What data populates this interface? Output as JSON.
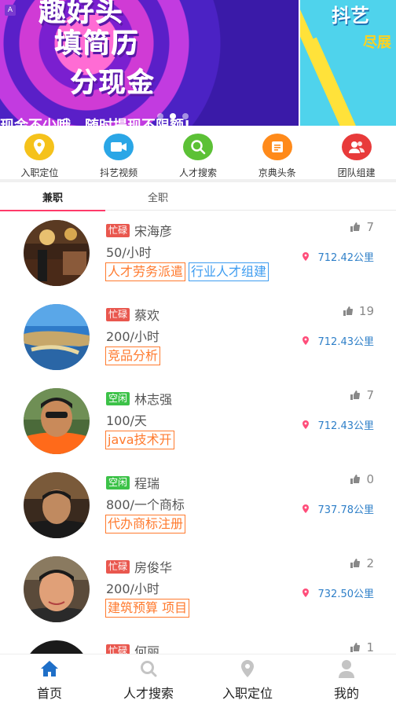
{
  "banner": {
    "ad_badge": "A",
    "line1": "趣好头",
    "line2": "填简历",
    "line3": "分现金",
    "ticker": "现金不少哦，随时提现不限额!",
    "side_line1": "抖艺",
    "side_line2": "尽展"
  },
  "quicknav": [
    {
      "label": "入职定位",
      "icon": "location-pin-icon",
      "color": "#f5c21b"
    },
    {
      "label": "抖艺视频",
      "icon": "video-camera-icon",
      "color": "#2aa6e6"
    },
    {
      "label": "人才搜索",
      "icon": "search-icon",
      "color": "#5cc136"
    },
    {
      "label": "京典头条",
      "icon": "news-icon",
      "color": "#ff8a1a"
    },
    {
      "label": "团队组建",
      "icon": "team-icon",
      "color": "#e83a3a"
    }
  ],
  "tabs": [
    {
      "label": "兼职",
      "active": true
    },
    {
      "label": "全职",
      "active": false
    }
  ],
  "items": [
    {
      "status": "忙碌",
      "status_type": "busy",
      "name": "宋海彦",
      "price": "50/小时",
      "tags": [
        {
          "text": "人才劳务派遣",
          "color": "orange"
        },
        {
          "text": "行业人才组建",
          "color": "blue"
        }
      ],
      "likes": "7",
      "distance": "712.42公里"
    },
    {
      "status": "忙碌",
      "status_type": "busy",
      "name": "蔡欢",
      "price": "200/小时",
      "tags": [
        {
          "text": "竞品分析",
          "color": "orange"
        }
      ],
      "likes": "19",
      "distance": "712.43公里"
    },
    {
      "status": "空闲",
      "status_type": "idle",
      "name": "林志强",
      "price": "100/天",
      "tags": [
        {
          "text": "java技术开",
          "color": "orange"
        }
      ],
      "likes": "7",
      "distance": "712.43公里"
    },
    {
      "status": "空闲",
      "status_type": "idle",
      "name": "程瑞",
      "price": "800/一个商标",
      "tags": [
        {
          "text": "代办商标注册",
          "color": "orange"
        }
      ],
      "likes": "0",
      "distance": "737.78公里"
    },
    {
      "status": "忙碌",
      "status_type": "busy",
      "name": "房俊华",
      "price": "200/小时",
      "tags": [
        {
          "text": "建筑预算 项目",
          "color": "orange"
        }
      ],
      "likes": "2",
      "distance": "732.50公里"
    },
    {
      "status": "忙碌",
      "status_type": "busy",
      "name": "何丽",
      "price": "",
      "tags": [],
      "likes": "1",
      "distance": ""
    }
  ],
  "bottomnav": [
    {
      "label": "首页",
      "icon": "home-icon",
      "active": true
    },
    {
      "label": "人才搜索",
      "icon": "search-icon",
      "active": false
    },
    {
      "label": "入职定位",
      "icon": "location-pin-icon",
      "active": false
    },
    {
      "label": "我的",
      "icon": "user-icon",
      "active": false
    }
  ],
  "colors": {
    "accent": "#ff3a6a",
    "busy": "#e9574e",
    "idle": "#3cc248",
    "tag_orange": "#ff7a2e",
    "tag_blue": "#3d9cf0",
    "distance": "#2e7fc8",
    "nav_active": "#1e6fc8"
  }
}
